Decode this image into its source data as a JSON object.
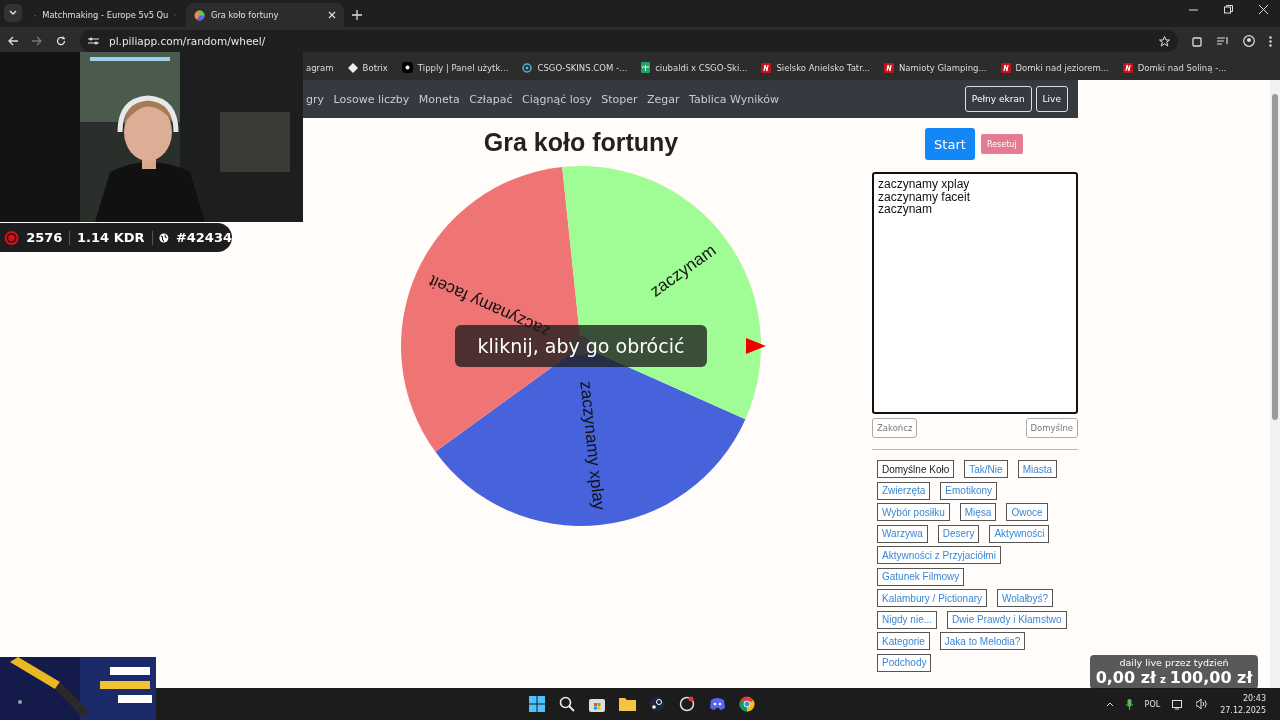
{
  "browser": {
    "tabs": [
      {
        "title": "Matchmaking - Europe 5v5 Qu",
        "selected": false
      },
      {
        "title": "Gra koło fortuny",
        "selected": true
      }
    ],
    "address": "pl.piliapp.com/random/wheel/",
    "bookmarks": [
      {
        "title": "agram",
        "kind": "none"
      },
      {
        "title": "Botrix",
        "kind": "diamond"
      },
      {
        "title": "Tipply | Panel użytk...",
        "kind": "tip"
      },
      {
        "title": "CSGO-SKINS.COM -...",
        "kind": "target"
      },
      {
        "title": "ciubaldi x CSGO-Ski...",
        "kind": "sheet"
      },
      {
        "title": "Sielsko Anielsko Tatr...",
        "kind": "red"
      },
      {
        "title": "Namioty Glamping...",
        "kind": "red"
      },
      {
        "title": "Domki nad jeziorem...",
        "kind": "red"
      },
      {
        "title": "Domki nad Soliną -...",
        "kind": "red"
      }
    ]
  },
  "stream_overlay": {
    "stats": {
      "rating": "2576",
      "kdr": "1.14 KDR",
      "rank": "#42434"
    },
    "goal": {
      "title": "daily live przez tydzień",
      "current": "0,00 zł",
      "separator": "z",
      "target": "100,00 zł"
    }
  },
  "navbar": {
    "links": [
      "gry",
      "Losowe liczby",
      "Moneta",
      "Człapać",
      "Ciągnąć losy",
      "Stoper",
      "Zegar",
      "Tablica Wyników"
    ],
    "buttons": [
      "Pełny ekran",
      "Live"
    ]
  },
  "title": "Gra koło fortuny",
  "wheel": {
    "segments": [
      {
        "label": "zaczynamy xplay",
        "color": "#4663dc"
      },
      {
        "label": "zaczynamy faceit",
        "color": "#ef7474"
      },
      {
        "label": "zaczynam",
        "color": "#a0fd96"
      }
    ],
    "hint": "kliknij, aby go obrócić"
  },
  "controls": {
    "start": "Start",
    "reset": "Resetuj"
  },
  "entries": {
    "value": "zaczynamy xplay\nzaczynamy faceit\nzaczynam"
  },
  "entry_buttons": [
    "Zakończ",
    "Domyślne"
  ],
  "presets": [
    {
      "label": "Domyślne Koło",
      "selected": true
    },
    {
      "label": "Tak/Nie",
      "selected": false
    },
    {
      "label": "Miasta",
      "selected": false
    },
    {
      "label": "Zwierzęta",
      "selected": false
    },
    {
      "label": "Emotikony",
      "selected": false
    },
    {
      "label": "Wybór posiłku",
      "selected": false
    },
    {
      "label": "Mięsa",
      "selected": false
    },
    {
      "label": "Owoce",
      "selected": false
    },
    {
      "label": "Warzywa",
      "selected": false
    },
    {
      "label": "Desery",
      "selected": false
    },
    {
      "label": "Aktywności",
      "selected": false
    },
    {
      "label": "Aktywności z Przyjaciółmi",
      "selected": false
    },
    {
      "label": "Gatunek Filmowy",
      "selected": false
    },
    {
      "label": "Kalambury / Pictionary",
      "selected": false
    },
    {
      "label": "Wolałbyś?",
      "selected": false
    },
    {
      "label": "Nigdy nie...",
      "selected": false
    },
    {
      "label": "Dwie Prawdy i Kłamstwo",
      "selected": false
    },
    {
      "label": "Kategorie",
      "selected": false
    },
    {
      "label": "Jaka to Melodia?",
      "selected": false
    },
    {
      "label": "Podchody",
      "selected": false
    }
  ],
  "taskbar": {
    "language": "POL",
    "time": "20:43",
    "date": "27.12.2025"
  }
}
